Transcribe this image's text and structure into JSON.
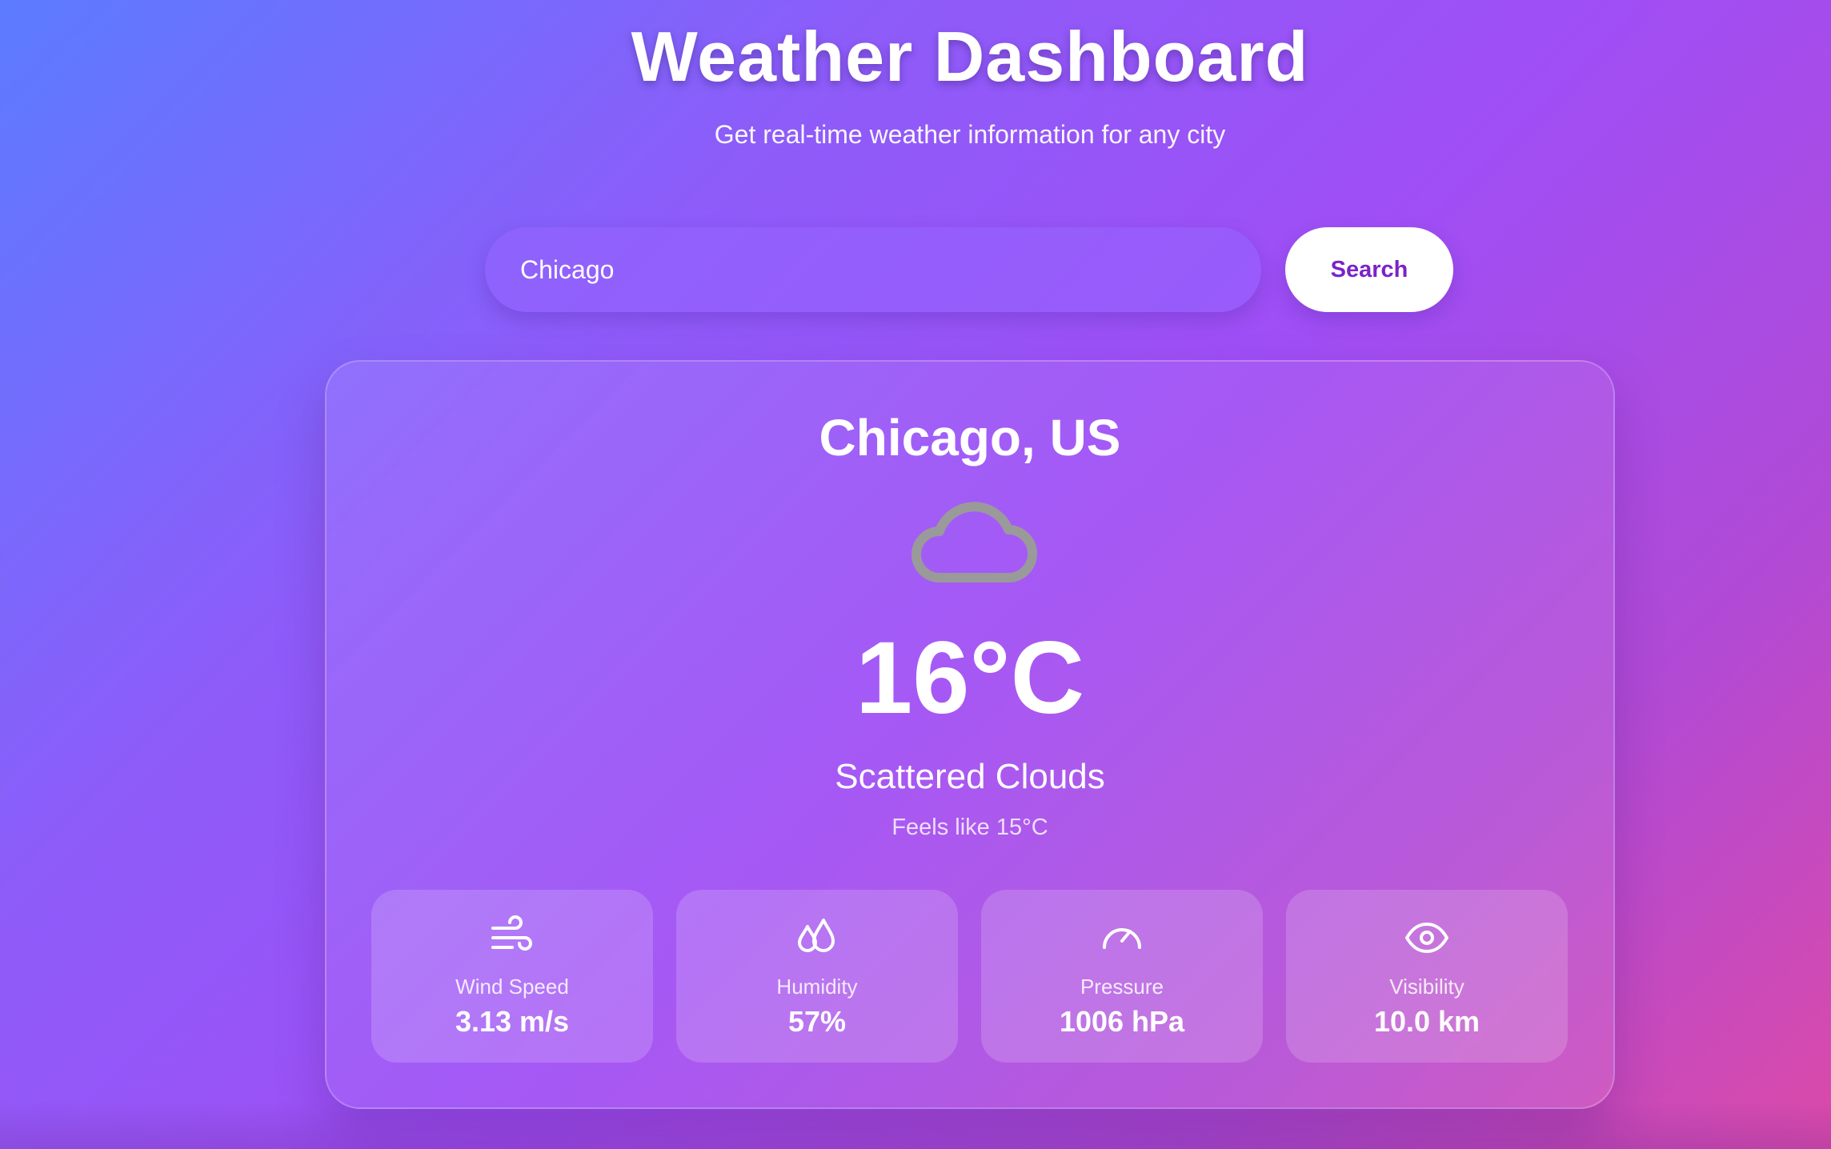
{
  "header": {
    "title": "Weather Dashboard",
    "subtitle": "Get real-time weather information for any city"
  },
  "search": {
    "value": "Chicago",
    "placeholder": "",
    "button_label": "Search"
  },
  "weather": {
    "location": "Chicago, US",
    "icon": "cloud-icon",
    "temperature": "16°C",
    "condition": "Scattered Clouds",
    "feels_like": "Feels like 15°C",
    "stats": [
      {
        "icon": "wind-icon",
        "label": "Wind Speed",
        "value": "3.13 m/s"
      },
      {
        "icon": "humidity-icon",
        "label": "Humidity",
        "value": "57%"
      },
      {
        "icon": "pressure-gauge-icon",
        "label": "Pressure",
        "value": "1006 hPa"
      },
      {
        "icon": "eye-icon",
        "label": "Visibility",
        "value": "10.0 km"
      }
    ]
  },
  "colors": {
    "background_start": "#5b7cff",
    "background_mid": "#a04ef5",
    "background_end": "#db4aa8",
    "search_button_text": "#7c22c9",
    "cloud_icon": "#9a9a9a"
  }
}
